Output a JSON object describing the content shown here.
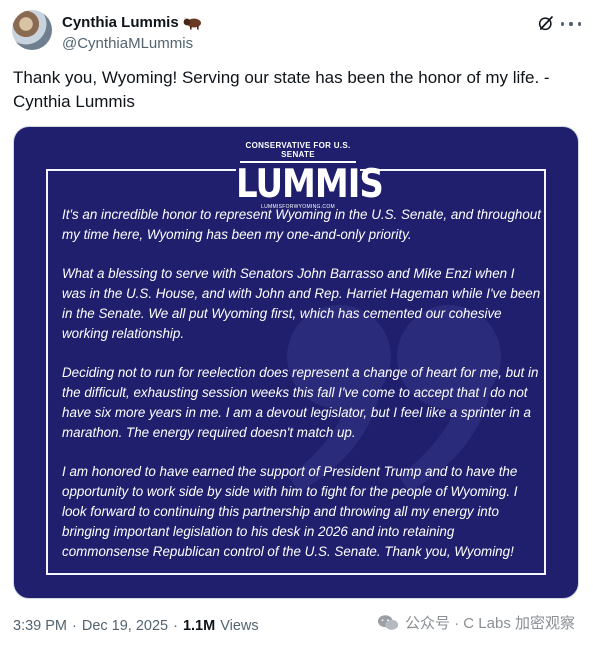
{
  "author": {
    "display_name": "Cynthia Lummis",
    "handle": "@CynthiaMLummis"
  },
  "tweet": {
    "text": "Thank you, Wyoming! Serving our state has been the honor of my life. - Cynthia Lummis"
  },
  "media": {
    "logo_top": "CONSERVATIVE FOR U.S. SENATE",
    "logo_main": "LUMMIS",
    "logo_url": "LUMMISFORWYOMING.COM",
    "paragraphs": [
      "It's an incredible honor to represent Wyoming in the U.S. Senate, and throughout my time here, Wyoming has been my one-and-only priority.",
      "What a blessing to serve with Senators John Barrasso and Mike Enzi when I was in the U.S. House, and with John and Rep. Harriet Hageman while I've been in the Senate. We all put Wyoming first, which has cemented our cohesive working relationship.",
      "Deciding not to run for reelection does represent a change of heart for me, but in the difficult, exhausting session weeks this fall I've come to accept that I do not have six more years in me. I am a devout legislator, but I feel like a sprinter in a marathon. The energy required doesn't match up.",
      "I am honored to have earned the support of President Trump and to have the opportunity to work side by side with him to fight for the people of Wyoming. I look forward to continuing this partnership and throwing all my energy into bringing important legislation to his desk in 2026 and into retaining commonsense Republican control of the U.S. Senate. Thank you, Wyoming!"
    ],
    "background_color": "#1f1f6e"
  },
  "meta": {
    "time": "3:39 PM",
    "separator": "·",
    "date": "Dec 19, 2025",
    "views_count": "1.1M",
    "views_label": "Views"
  },
  "watermark": {
    "text": "公众号 · C Labs 加密观察"
  },
  "icons": {
    "name_emoji": "bison-icon",
    "grok": "grok-icon",
    "more": "more-icon",
    "watermark": "wechat-icon"
  }
}
